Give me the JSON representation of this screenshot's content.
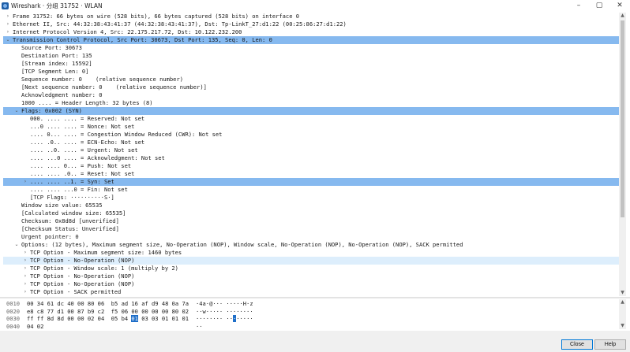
{
  "window": {
    "title": "Wireshark · 分组 31752 · WLAN",
    "minimize": "–",
    "maximize": "▢",
    "close": "✕"
  },
  "tree": [
    {
      "indent": 0,
      "arrow": "›",
      "text": "Frame 31752: 66 bytes on wire (528 bits), 66 bytes captured (528 bits) on interface 0",
      "hl": ""
    },
    {
      "indent": 0,
      "arrow": "›",
      "text": "Ethernet II, Src: 44:32:38:43:41:37 (44:32:38:43:41:37), Dst: Tp-LinkT_27:d1:22 (00:25:86:27:d1:22)",
      "hl": ""
    },
    {
      "indent": 0,
      "arrow": "›",
      "text": "Internet Protocol Version 4, Src: 22.175.217.72, Dst: 10.122.232.200",
      "hl": ""
    },
    {
      "indent": 0,
      "arrow": "⌄",
      "text": "Transmission Control Protocol, Src Port: 30673, Dst Port: 135, Seq: 0, Len: 0",
      "hl": "strong"
    },
    {
      "indent": 1,
      "arrow": "",
      "text": "Source Port: 30673",
      "hl": ""
    },
    {
      "indent": 1,
      "arrow": "",
      "text": "Destination Port: 135",
      "hl": ""
    },
    {
      "indent": 1,
      "arrow": "",
      "text": "[Stream index: 15592]",
      "hl": ""
    },
    {
      "indent": 1,
      "arrow": "",
      "text": "[TCP Segment Len: 0]",
      "hl": ""
    },
    {
      "indent": 1,
      "arrow": "",
      "text": "Sequence number: 0    (relative sequence number)",
      "hl": ""
    },
    {
      "indent": 1,
      "arrow": "",
      "text": "[Next sequence number: 0    (relative sequence number)]",
      "hl": ""
    },
    {
      "indent": 1,
      "arrow": "",
      "text": "Acknowledgment number: 0",
      "hl": ""
    },
    {
      "indent": 1,
      "arrow": "",
      "text": "1000 .... = Header Length: 32 bytes (8)",
      "hl": ""
    },
    {
      "indent": 1,
      "arrow": "⌄",
      "text": "Flags: 0x002 (SYN)",
      "hl": "strong"
    },
    {
      "indent": 2,
      "arrow": "",
      "text": "000. .... .... = Reserved: Not set",
      "hl": ""
    },
    {
      "indent": 2,
      "arrow": "",
      "text": "...0 .... .... = Nonce: Not set",
      "hl": ""
    },
    {
      "indent": 2,
      "arrow": "",
      "text": ".... 0... .... = Congestion Window Reduced (CWR): Not set",
      "hl": ""
    },
    {
      "indent": 2,
      "arrow": "",
      "text": ".... .0.. .... = ECN-Echo: Not set",
      "hl": ""
    },
    {
      "indent": 2,
      "arrow": "",
      "text": ".... ..0. .... = Urgent: Not set",
      "hl": ""
    },
    {
      "indent": 2,
      "arrow": "",
      "text": ".... ...0 .... = Acknowledgment: Not set",
      "hl": ""
    },
    {
      "indent": 2,
      "arrow": "",
      "text": ".... .... 0... = Push: Not set",
      "hl": ""
    },
    {
      "indent": 2,
      "arrow": "",
      "text": ".... .... .0.. = Reset: Not set",
      "hl": ""
    },
    {
      "indent": 2,
      "arrow": "›",
      "text": ".... .... ..1. = Syn: Set",
      "hl": "strong"
    },
    {
      "indent": 2,
      "arrow": "",
      "text": ".... .... ...0 = Fin: Not set",
      "hl": ""
    },
    {
      "indent": 2,
      "arrow": "",
      "text": "[TCP Flags: ··········S·]",
      "hl": ""
    },
    {
      "indent": 1,
      "arrow": "",
      "text": "Window size value: 65535",
      "hl": ""
    },
    {
      "indent": 1,
      "arrow": "",
      "text": "[Calculated window size: 65535]",
      "hl": ""
    },
    {
      "indent": 1,
      "arrow": "",
      "text": "Checksum: 0x8d8d [unverified]",
      "hl": ""
    },
    {
      "indent": 1,
      "arrow": "",
      "text": "[Checksum Status: Unverified]",
      "hl": ""
    },
    {
      "indent": 1,
      "arrow": "",
      "text": "Urgent pointer: 0",
      "hl": ""
    },
    {
      "indent": 1,
      "arrow": "⌄",
      "text": "Options: (12 bytes), Maximum segment size, No-Operation (NOP), Window scale, No-Operation (NOP), No-Operation (NOP), SACK permitted",
      "hl": ""
    },
    {
      "indent": 2,
      "arrow": "›",
      "text": "TCP Option - Maximum segment size: 1460 bytes",
      "hl": ""
    },
    {
      "indent": 2,
      "arrow": "›",
      "text": "TCP Option - No-Operation (NOP)",
      "hl": "light"
    },
    {
      "indent": 2,
      "arrow": "›",
      "text": "TCP Option - Window scale: 1 (multiply by 2)",
      "hl": ""
    },
    {
      "indent": 2,
      "arrow": "›",
      "text": "TCP Option - No-Operation (NOP)",
      "hl": ""
    },
    {
      "indent": 2,
      "arrow": "›",
      "text": "TCP Option - No-Operation (NOP)",
      "hl": ""
    },
    {
      "indent": 2,
      "arrow": "›",
      "text": "TCP Option - SACK permitted",
      "hl": ""
    }
  ],
  "bytes": [
    {
      "offset": "0010",
      "hex_pre": "00 34 61 dc 40 00 80 06  b5 ad 16 af d9 48 0a 7a",
      "hex_sel": "",
      "hex_post": "",
      "ascii_pre": "·4a·@··· ·····H·z",
      "ascii_sel": "",
      "ascii_post": ""
    },
    {
      "offset": "0020",
      "hex_pre": "e8 c8 77 d1 00 87 b9 c2  f5 06 00 00 00 00 80 02",
      "hex_sel": "",
      "hex_post": "",
      "ascii_pre": "··w····· ········",
      "ascii_sel": "",
      "ascii_post": ""
    },
    {
      "offset": "0030",
      "hex_pre": "ff ff 8d 8d 00 00 02 04  05 b4 ",
      "hex_sel": "01",
      "hex_post": " 03 03 01 01 01",
      "ascii_pre": "········ ··",
      "ascii_sel": "·",
      "ascii_post": "·····"
    },
    {
      "offset": "0040",
      "hex_pre": "04 02",
      "hex_sel": "",
      "hex_post": "",
      "ascii_pre": "··",
      "ascii_sel": "",
      "ascii_post": ""
    }
  ],
  "buttons": {
    "close": "Close",
    "help": "Help"
  }
}
